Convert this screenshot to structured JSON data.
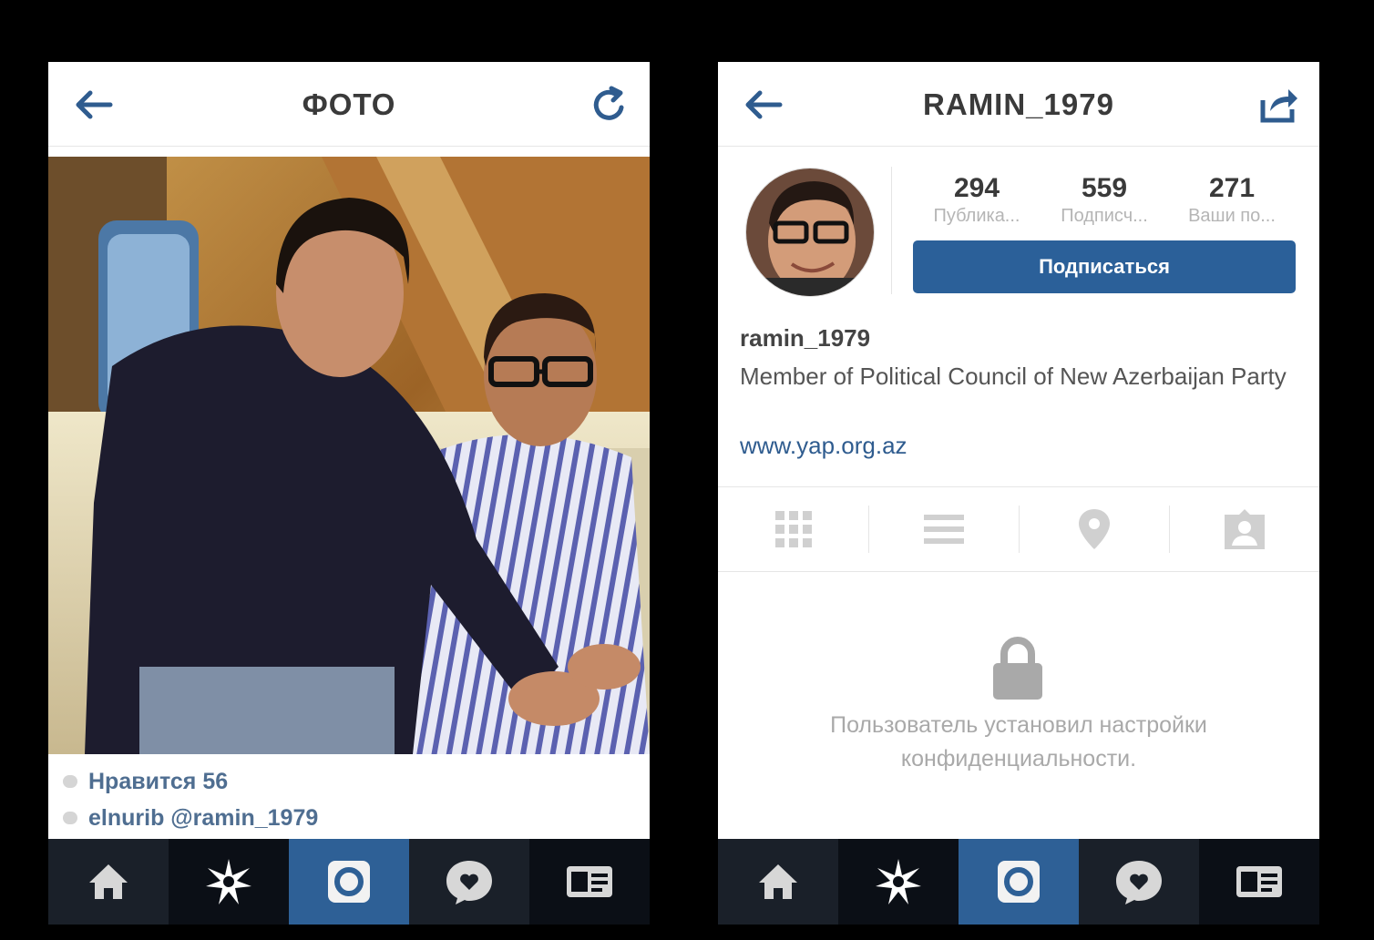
{
  "left_screen": {
    "title": "ФОТО",
    "back_icon": "arrow-left-icon",
    "refresh_icon": "refresh-icon",
    "likes": "Нравится 56",
    "comment_user": "elnurib",
    "comment_text": " @ramin_1979"
  },
  "right_screen": {
    "title": "RAMIN_1979",
    "back_icon": "arrow-left-icon",
    "share_icon": "share-icon",
    "stats": [
      {
        "count": "294",
        "label": "Публика..."
      },
      {
        "count": "559",
        "label": "Подписч..."
      },
      {
        "count": "271",
        "label": "Ваши по..."
      }
    ],
    "follow_button": "Подписаться",
    "username": "ramin_1979",
    "bio": "Member of Political Council of New Azerbaijan Party",
    "website": "www.yap.org.az",
    "private_message": "Пользователь установил настройки конфиденциальности."
  },
  "tabbar": [
    "home-icon",
    "explore-star-icon",
    "camera-icon",
    "activity-heart-icon",
    "profile-card-icon"
  ],
  "colors": {
    "accent": "#2e6096",
    "link": "#2f5c8f",
    "tabbar": "#0b0f16"
  }
}
